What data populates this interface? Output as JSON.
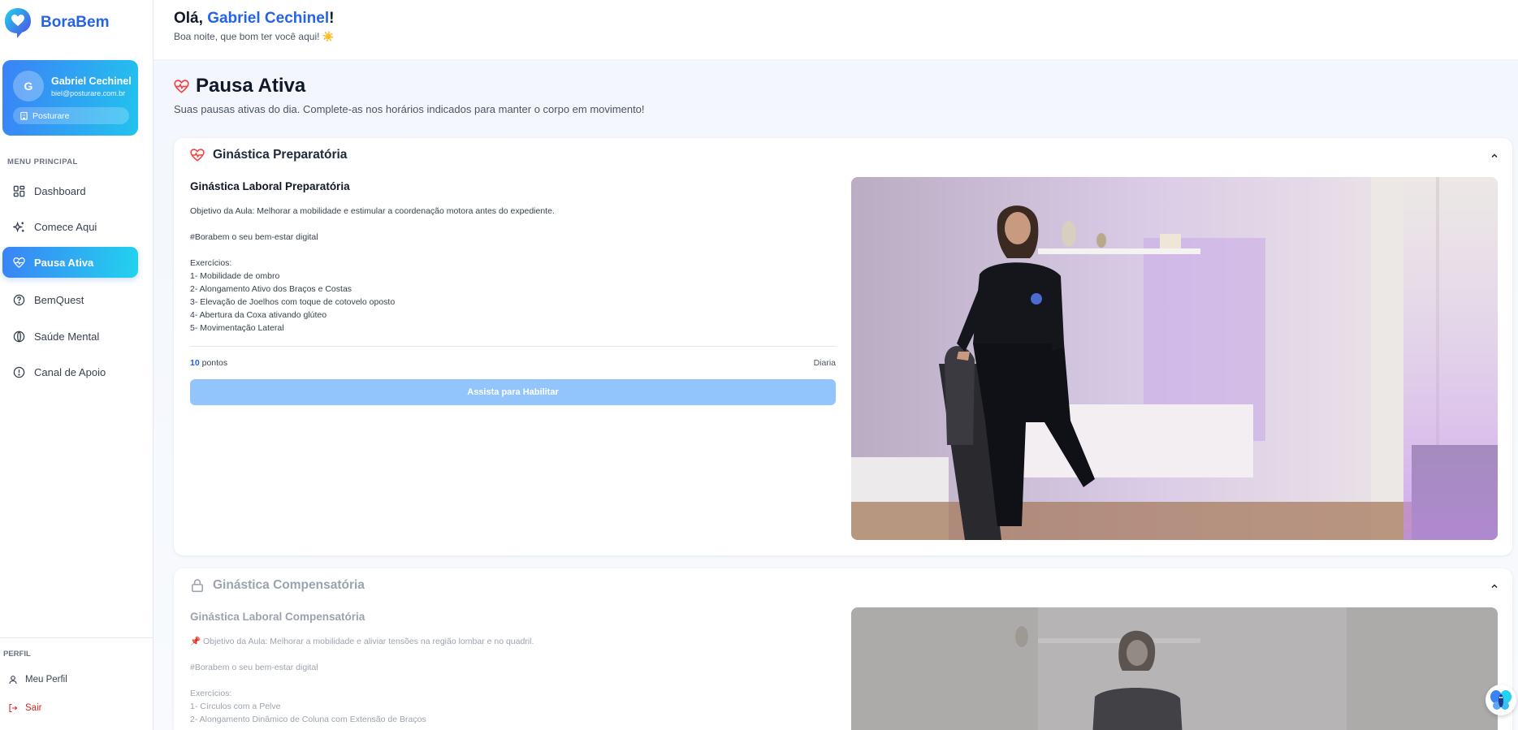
{
  "brand": {
    "name": "BoraBem"
  },
  "user": {
    "initial": "G",
    "name": "Gabriel Cechinel",
    "email": "biel@posturare.com.br",
    "company": "Posturare"
  },
  "menu": {
    "heading": "MENU PRINCIPAL",
    "items": [
      {
        "label": "Dashboard",
        "icon": "grid-icon"
      },
      {
        "label": "Comece Aqui",
        "icon": "sparkles-icon"
      },
      {
        "label": "Pausa Ativa",
        "icon": "heart-pulse-icon",
        "active": true
      },
      {
        "label": "BemQuest",
        "icon": "question-circle-icon"
      },
      {
        "label": "Saúde Mental",
        "icon": "mind-icon"
      },
      {
        "label": "Canal de Apoio",
        "icon": "alert-circle-icon"
      }
    ]
  },
  "profile": {
    "heading": "PERFIL",
    "my_profile": "Meu Perfil",
    "logout": "Sair"
  },
  "header": {
    "greeting_prefix": "Olá, ",
    "greeting_name": "Gabriel Cechinel",
    "greeting_suffix": "!",
    "subtitle": "Boa noite, que bom ter você aqui! ☀️"
  },
  "page": {
    "title": "Pausa Ativa",
    "description": "Suas pausas ativas do dia. Complete-as nos horários indicados para manter o corpo em movimento!"
  },
  "cards": [
    {
      "title": "Ginástica Preparatória",
      "status_icon": "heart-pulse-icon",
      "lesson_title": "Ginástica Laboral Preparatória",
      "lines": [
        "Objetivo da Aula: Melhorar a mobilidade e estimular a coordenação motora antes do expediente.",
        "",
        "#Borabem o seu bem-estar digital",
        "",
        "Exercícios:",
        "1- Mobilidade de ombro",
        "2- Alongamento Ativo dos Braços e Costas",
        "3- Elevação de Joelhos com toque de cotovelo oposto",
        "4- Abertura da Coxa ativando glúteo",
        "5- Movimentação Lateral"
      ],
      "points_value": "10",
      "points_label": " pontos",
      "frequency": "Diaria",
      "button_label": "Assista para Habilitar"
    },
    {
      "title": "Ginástica Compensatória",
      "status_icon": "lock-icon",
      "lesson_title": "Ginástica Laboral Compensatória",
      "lines": [
        "📌 Objetivo da Aula: Melhorar a mobilidade e aliviar tensões na região lombar e no quadril.",
        "",
        "#Borabem o seu bem-estar digital",
        "",
        "Exercícios:",
        "1- Círculos com a Pelve",
        "2- Alongamento Dinâmico de Coluna com Extensão de Braços"
      ]
    }
  ],
  "colors": {
    "brand_blue": "#2563eb",
    "gradient_start": "#3b82f6",
    "gradient_end": "#22d3ee",
    "disabled_button": "#93c5fd",
    "heart_red": "#ef4444"
  }
}
